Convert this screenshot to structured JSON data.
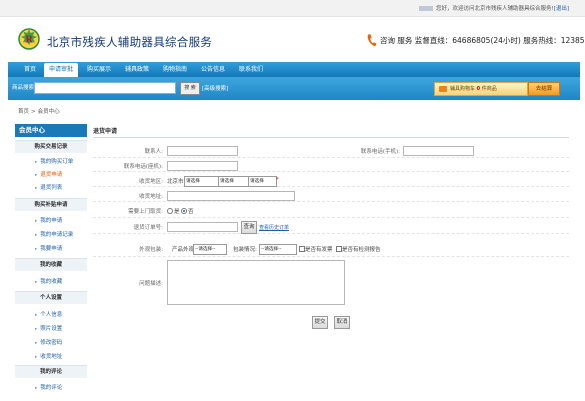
{
  "topbar": {
    "welcome_prefix": "您好，欢迎访问北京市残疾人辅助器具综合服务!",
    "logout_label": "[退出]"
  },
  "header": {
    "site_title": "北京市残疾人辅助器具综合服务",
    "hotline": "咨询 服务 监督直线：64686805(24小时)   服务热线：12385"
  },
  "nav": {
    "items": [
      {
        "label": "首页"
      },
      {
        "label": "申请审批"
      },
      {
        "label": "购买展示"
      },
      {
        "label": "辅具政策"
      },
      {
        "label": "购物指南"
      },
      {
        "label": "公告信息"
      },
      {
        "label": "联系我们"
      }
    ],
    "active_index": 1
  },
  "search": {
    "label": "商品搜索:",
    "value": "",
    "button_label": "搜 索",
    "advanced_label": "[高级搜索]"
  },
  "cart": {
    "prefix": "辅具购物车",
    "count": "0",
    "suffix": "件商品",
    "checkout_label": "去结算"
  },
  "breadcrumb": {
    "home": "首页",
    "separator": ">",
    "current": "会员中心"
  },
  "sidebar": {
    "title": "会员中心",
    "groups": [
      {
        "title": "购买交易记录",
        "items": [
          "我的购买订单",
          "退货申请",
          "退货列表"
        ]
      },
      {
        "title": "购买补贴申请",
        "items": [
          "我的申请",
          "我的申请记录",
          "我要申请"
        ]
      },
      {
        "title": "我的收藏",
        "items": [
          "我的收藏"
        ]
      },
      {
        "title": "个人设置",
        "items": [
          "个人信息",
          "照片设置",
          "修改密码",
          "收货地址"
        ]
      },
      {
        "title": "我的评论",
        "items": [
          "我的评论"
        ]
      }
    ],
    "active_item": "退货申请"
  },
  "form": {
    "title": "退货申请",
    "contact_label": "联系人:",
    "contact_value": "",
    "contact_phone_label": "联系电话(手机):",
    "contact_phone_value": "",
    "landline_label": "联系电话(座机):",
    "landline_value": "",
    "region_label": "收货地区:",
    "region_prefix": "北京市",
    "region_select1": "请选择",
    "region_select2": "请选择",
    "region_select3": "请选择",
    "required_mark": "*",
    "address_label": "收货地址:",
    "address_value": "",
    "pickup_label": "需要上门取货:",
    "pickup_no": "是",
    "pickup_yes": "否",
    "order_label": "退货订单号:",
    "order_value": "",
    "query_button": "查询",
    "view_orders_link": "查看历史订单",
    "appearance_label": "外观包装:",
    "product_appearance_label": "产品外观:",
    "product_appearance_value": "--请选择--",
    "package_label": "包装情况:",
    "package_value": "--请选择--",
    "invoice_label": "是否有发票",
    "report_label": "是否有检测报告",
    "problem_label": "问题描述:",
    "problem_value": "",
    "submit_label": "提交",
    "cancel_label": "取消"
  },
  "colors": {
    "nav_blue": "#1a7ab9",
    "link_blue": "#1f5fa8",
    "active_orange": "#e35a00",
    "title_navy": "#123a76"
  }
}
